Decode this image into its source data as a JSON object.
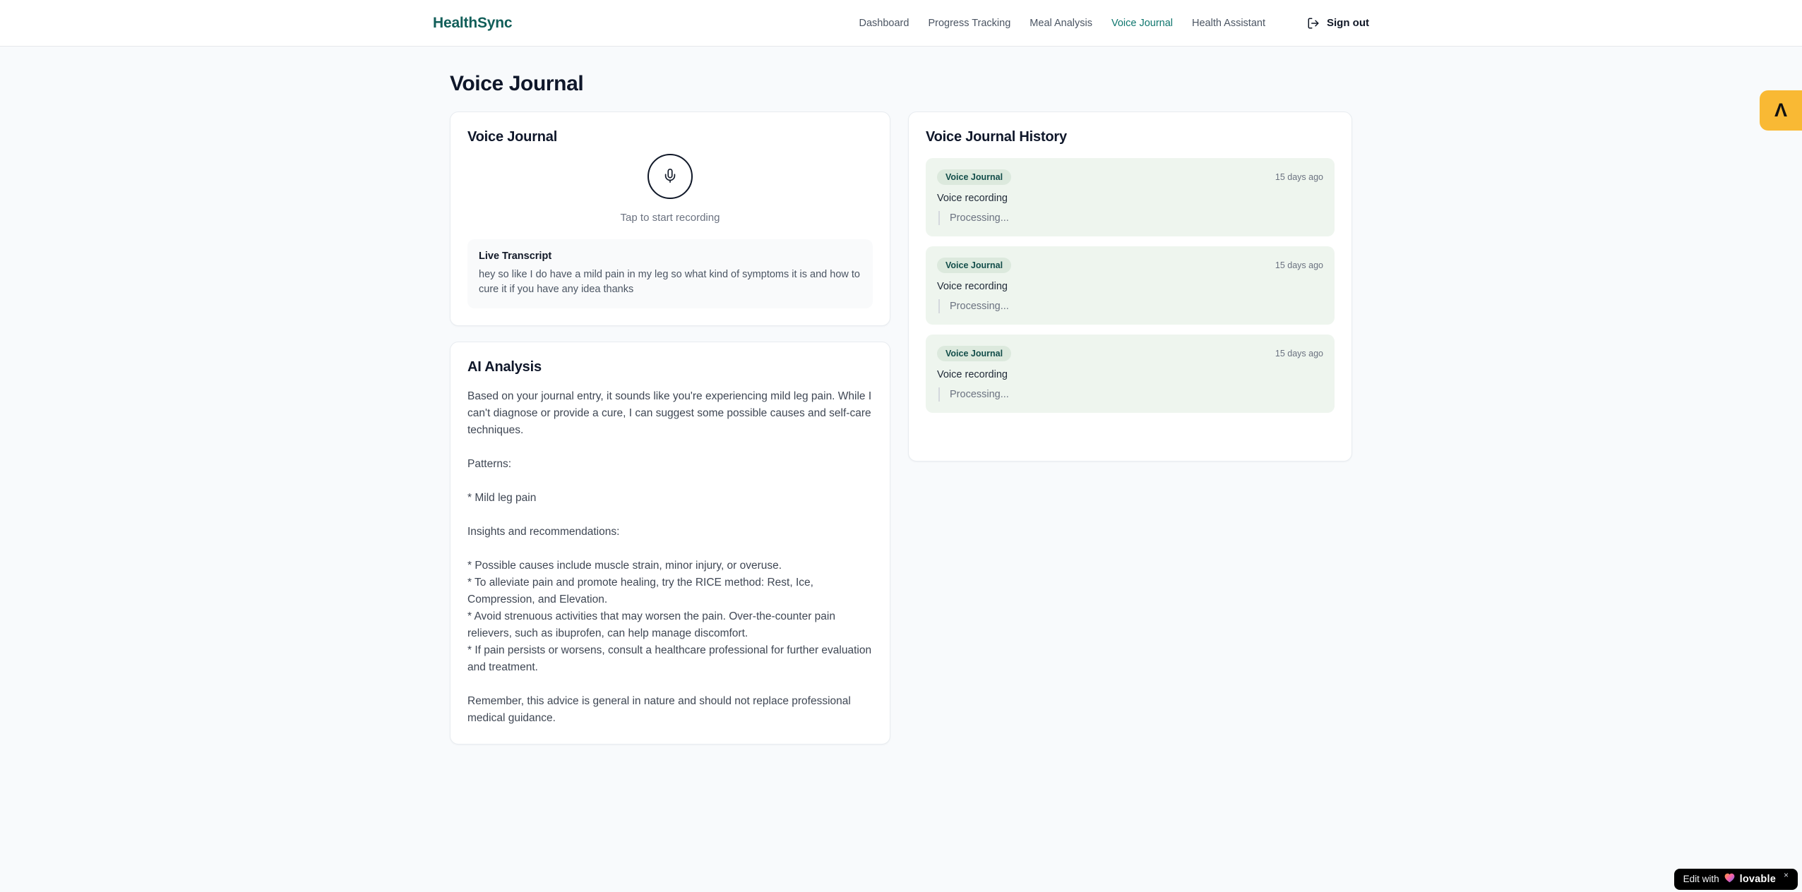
{
  "header": {
    "logo": "HealthSync",
    "nav": [
      "Dashboard",
      "Progress Tracking",
      "Meal Analysis",
      "Voice Journal",
      "Health Assistant"
    ],
    "active_nav": "Voice Journal",
    "sign_out_label": "Sign out"
  },
  "page": {
    "title": "Voice Journal"
  },
  "recorder": {
    "card_title": "Voice Journal",
    "tap_hint": "Tap to start recording",
    "live_transcript_label": "Live Transcript",
    "transcript": "hey so like I do have a mild pain in my leg so what kind of symptoms it is and how to cure it if you have any idea thanks"
  },
  "analysis": {
    "card_title": "AI Analysis",
    "body": "Based on your journal entry, it sounds like you're experiencing mild leg pain. While I can't diagnose or provide a cure, I can suggest some possible causes and self-care techniques.\n\nPatterns:\n\n* Mild leg pain\n\nInsights and recommendations:\n\n* Possible causes include muscle strain, minor injury, or overuse.\n* To alleviate pain and promote healing, try the RICE method: Rest, Ice, Compression, and Elevation.\n* Avoid strenuous activities that may worsen the pain. Over-the-counter pain relievers, such as ibuprofen, can help manage discomfort.\n* If pain persists or worsens, consult a healthcare professional for further evaluation and treatment.\n\nRemember, this advice is general in nature and should not replace professional medical guidance."
  },
  "history": {
    "card_title": "Voice Journal History",
    "entries": [
      {
        "badge": "Voice Journal",
        "time": "15 days ago",
        "title": "Voice recording",
        "status": "Processing..."
      },
      {
        "badge": "Voice Journal",
        "time": "15 days ago",
        "title": "Voice recording",
        "status": "Processing..."
      },
      {
        "badge": "Voice Journal",
        "time": "15 days ago",
        "title": "Voice recording",
        "status": "Processing..."
      }
    ]
  },
  "overlays": {
    "side_badge_glyph": "Λ",
    "edit_badge": {
      "prefix": "Edit with",
      "brand": "lovable",
      "close": "×"
    }
  },
  "icons": [
    "microphone-icon",
    "log-out-icon",
    "heart-icon",
    "lambda-logo-icon"
  ],
  "colors": {
    "brand_teal": "#115e59",
    "nav_active": "#0f766e",
    "page_bg": "#f8fafc",
    "entry_bg": "#eef5ee",
    "badge_bg": "#dce9dd",
    "badge_text": "#134e4a",
    "amber_badge": "#f9b934",
    "muted_text": "#6b7280"
  }
}
